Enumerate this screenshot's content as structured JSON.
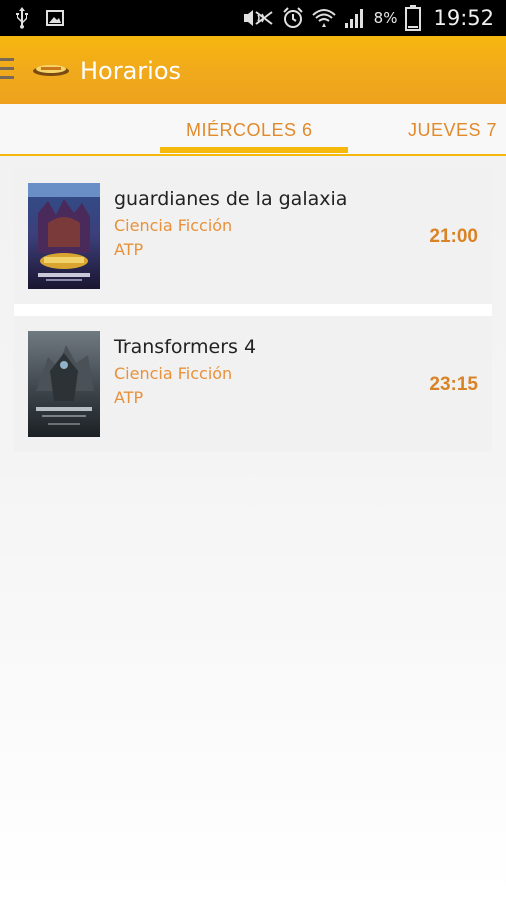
{
  "status_bar": {
    "battery": "8%",
    "time": "19:52",
    "icons": [
      "usb-icon",
      "image-icon",
      "mute-icon",
      "alarm-icon",
      "wifi-icon",
      "signal-icon",
      "battery-icon"
    ]
  },
  "action_bar": {
    "title": "Horarios",
    "menu_icon": "menu-icon",
    "logo_icon": "app-logo-icon"
  },
  "tabs": [
    {
      "label": "MIÉRCOLES 6",
      "active": true
    },
    {
      "label": "JUEVES 7",
      "active": false
    }
  ],
  "movies": [
    {
      "title": "guardianes de la galaxia",
      "genre": "Ciencia Ficción",
      "rating": "ATP",
      "time": "21:00"
    },
    {
      "title": "Transformers 4",
      "genre": "Ciencia Ficción",
      "rating": "ATP",
      "time": "23:15"
    }
  ],
  "colors": {
    "accent": "#f5b90b",
    "action_bar": "#f0a91c",
    "text_accent": "#e08a2c"
  }
}
